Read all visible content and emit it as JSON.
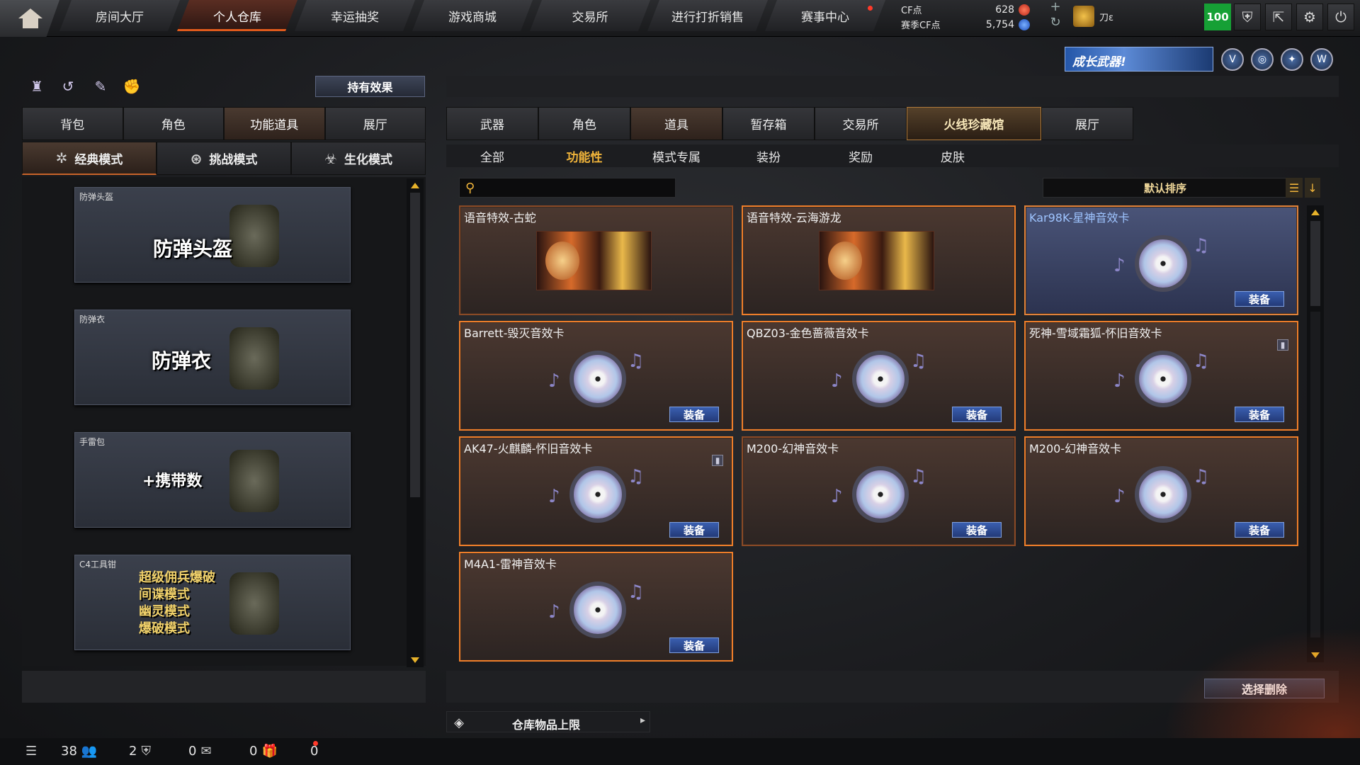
{
  "topnav": {
    "tabs": [
      {
        "label": "房间大厅",
        "active": false
      },
      {
        "label": "个人仓库",
        "active": true
      },
      {
        "label": "幸运抽奖",
        "active": false
      },
      {
        "label": "游戏商城",
        "active": false
      },
      {
        "label": "交易所",
        "active": false
      },
      {
        "label": "进行打折销售",
        "active": false
      },
      {
        "label": "赛事中心",
        "active": false,
        "badge": "red-dot"
      }
    ],
    "currency": {
      "cf_label": "CF点",
      "cf_value": "628",
      "season_label": "赛季CF点",
      "season_value": "5,754"
    },
    "rank_text": "刀ε",
    "level": "100",
    "icons": [
      "shield-icon",
      "exit-icon",
      "settings-gear-icon",
      "power-icon"
    ]
  },
  "banner": {
    "text": "成长武器!",
    "icons": [
      "v-badge-icon",
      "globe-badge-icon",
      "crest-badge-icon",
      "w-badge-icon"
    ]
  },
  "left_panel": {
    "quick_icons": [
      "trophy-icon",
      "swirl-icon",
      "feather-icon",
      "fist-icon"
    ],
    "effect_button": "持有效果",
    "tabs": [
      {
        "label": "背包",
        "active": false
      },
      {
        "label": "角色",
        "active": false
      },
      {
        "label": "功能道具",
        "active": true
      },
      {
        "label": "展厅",
        "active": false
      }
    ],
    "modes": [
      {
        "label": "经典模式",
        "icon": "star-icon",
        "active": true
      },
      {
        "label": "挑战模式",
        "icon": "challenge-icon",
        "active": false
      },
      {
        "label": "生化模式",
        "icon": "biohazard-icon",
        "active": false
      }
    ],
    "items": [
      {
        "category": "防弹头盔",
        "title": "防弹头盔"
      },
      {
        "category": "防弹衣",
        "title": "防弹衣"
      },
      {
        "category": "手雷包",
        "title": "+携带数"
      },
      {
        "category": "C4工具钳",
        "title": "超级佣兵爆破\n间谍模式\n幽灵模式\n爆破模式"
      }
    ]
  },
  "right_panel": {
    "tabs": [
      {
        "label": "武器",
        "active": false
      },
      {
        "label": "角色",
        "active": false
      },
      {
        "label": "道具",
        "active": true
      },
      {
        "label": "暂存箱",
        "active": false
      },
      {
        "label": "交易所",
        "active": false
      },
      {
        "label": "火线珍藏馆",
        "active": false,
        "special": true
      },
      {
        "label": "展厅",
        "active": false
      }
    ],
    "subtabs": [
      {
        "label": "全部",
        "active": false
      },
      {
        "label": "功能性",
        "active": true
      },
      {
        "label": "模式专属",
        "active": false
      },
      {
        "label": "装扮",
        "active": false
      },
      {
        "label": "奖励",
        "active": false
      },
      {
        "label": "皮肤",
        "active": false
      }
    ],
    "search_placeholder": "",
    "sort_label": "默认排序",
    "items": [
      {
        "name": "语音特效-古蛇",
        "kind": "art",
        "equip": ""
      },
      {
        "name": "语音特效-云海游龙",
        "kind": "art",
        "equip": ""
      },
      {
        "name": "Kar98K-星神音效卡",
        "kind": "disc",
        "equip": "装备",
        "highlight": "blue"
      },
      {
        "name": "Barrett-毁灭音效卡",
        "kind": "disc",
        "equip": "装备"
      },
      {
        "name": "QBZ03-金色蔷薇音效卡",
        "kind": "disc",
        "equip": "装备"
      },
      {
        "name": "死神-雪域霜狐-怀旧音效卡",
        "kind": "disc",
        "equip": "装备",
        "trash": true
      },
      {
        "name": "AK47-火麒麟-怀旧音效卡",
        "kind": "disc",
        "equip": "装备",
        "trash": true
      },
      {
        "name": "M200-幻神音效卡",
        "kind": "disc",
        "equip": "装备"
      },
      {
        "name": "M200-幻神音效卡",
        "kind": "disc",
        "equip": "装备"
      },
      {
        "name": "M4A1-雷神音效卡",
        "kind": "disc",
        "equip": "装备"
      }
    ],
    "delete_button": "选择删除",
    "capacity_label": "仓库物品上限"
  },
  "statusbar": {
    "items": [
      {
        "icon": "list-icon",
        "value": ""
      },
      {
        "icon": "friends-icon",
        "value": "38"
      },
      {
        "icon": "shield-small-icon",
        "value": "2"
      },
      {
        "icon": "chat-icon",
        "value": "0"
      },
      {
        "icon": "gift-icon",
        "value": "0"
      },
      {
        "icon": "",
        "value": "0"
      }
    ]
  }
}
